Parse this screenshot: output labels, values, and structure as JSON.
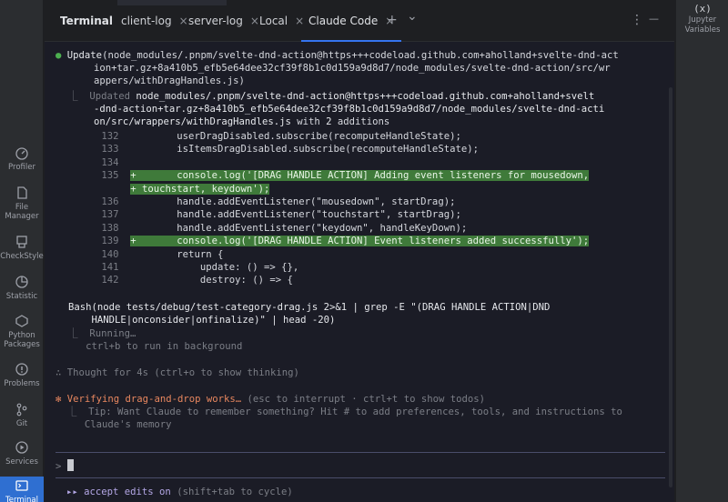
{
  "tabs": {
    "title": "Terminal",
    "items": [
      "client-log",
      "server-log",
      "Local",
      "Claude Code"
    ],
    "active": "Claude Code",
    "close_glyph": "×",
    "add_glyph": "+",
    "dropdown_glyph": "⌄",
    "more_glyph": "⋮",
    "minimize_glyph": "—"
  },
  "right_tools": {
    "jupyter": {
      "icon": "(x)",
      "line1": "Jupyter",
      "line2": "Variables"
    }
  },
  "left_tools": [
    {
      "line1": "Profiler",
      "line2": "",
      "icon": "gauge-icon"
    },
    {
      "line1": "File",
      "line2": "Manager",
      "icon": "file-icon"
    },
    {
      "line1": "CheckStyle",
      "line2": "",
      "icon": "checkstyle-icon"
    },
    {
      "line1": "Statistic",
      "line2": "",
      "icon": "statistic-icon"
    },
    {
      "line1": "Python",
      "line2": "Packages",
      "icon": "python-packages-icon"
    },
    {
      "line1": "Problems",
      "line2": "",
      "icon": "problems-icon"
    },
    {
      "line1": "Git",
      "line2": "",
      "icon": "git-icon"
    },
    {
      "line1": "Services",
      "line2": "",
      "icon": "services-icon"
    },
    {
      "line1": "Terminal",
      "line2": "",
      "icon": "terminal-icon"
    }
  ],
  "terminal": {
    "update": {
      "bullet": "●",
      "label": "Update",
      "path1": "(node_modules/.pnpm/svelte-dnd-action@https+++codeload.github.com+aholland+svelte-dnd-act",
      "path2": "ion+tar.gz+8a410b5_efb5e64dee32cf39f8b1c0d159a9d8d7/node_modules/svelte-dnd-action/src/wr",
      "path3": "appers/withDragHandles.js)",
      "result_prefix": "⎿  Updated ",
      "result1": "node_modules/.pnpm/svelte-dnd-action@https+++codeload.github.com+aholland+svelt",
      "result2": "-dnd-action+tar.gz+8a410b5_efb5e64dee32cf39f8b1c0d159a9d8d7/node_modules/svelte-dnd-acti",
      "result3": "on/src/wrappers/withDragHandles.js",
      "result3_suffix": " with ",
      "additions_count": "2",
      "additions_word": " additions"
    },
    "diff": [
      {
        "num": "132",
        "code": "        userDragDisabled.subscribe(recomputeHandleState);",
        "added": false
      },
      {
        "num": "133",
        "code": "        isItemsDragDisabled.subscribe(recomputeHandleState);",
        "added": false
      },
      {
        "num": "134",
        "code": "",
        "added": false
      },
      {
        "num": "135",
        "code": "+       console.log('[DRAG HANDLE ACTION] Adding event listeners for mousedown,",
        "added": true
      },
      {
        "num": "",
        "code": "+ touchstart, keydown');",
        "added": true
      },
      {
        "num": "136",
        "code": "        handle.addEventListener(\"mousedown\", startDrag);",
        "added": false
      },
      {
        "num": "137",
        "code": "        handle.addEventListener(\"touchstart\", startDrag);",
        "added": false
      },
      {
        "num": "138",
        "code": "        handle.addEventListener(\"keydown\", handleKeyDown);",
        "added": false
      },
      {
        "num": "139",
        "code": "+       console.log('[DRAG HANDLE ACTION] Event listeners added successfully');",
        "added": true
      },
      {
        "num": "140",
        "code": "        return {",
        "added": false
      },
      {
        "num": "141",
        "code": "            update: () => {},",
        "added": false
      },
      {
        "num": "142",
        "code": "            destroy: () => {",
        "added": false
      }
    ],
    "bash": {
      "line1": "Bash(node tests/debug/test-category-drag.js 2>&1 | grep -E \"(DRAG HANDLE ACTION|DND",
      "line2": "    HANDLE|onconsider|onfinalize)\" | head -20)",
      "running": "⎿  Running…",
      "hint": "   ctrl+b to run in background"
    },
    "thought": "∴ Thought for 4s (ctrl+o to show thinking)",
    "status": {
      "star": "✻",
      "label": " Verifying drag-and-drop works…",
      "hint": " (esc to interrupt · ctrl+t to show todos)",
      "tip1": "  ⎿  Tip: Want Claude to remember something? Hit # to add preferences, tools, and instructions to",
      "tip2": "     Claude's memory"
    },
    "prompt": ">",
    "footer": {
      "arrows": "▸▸",
      "text": " accept edits on",
      "hint": " (shift+tab to cycle)"
    }
  }
}
